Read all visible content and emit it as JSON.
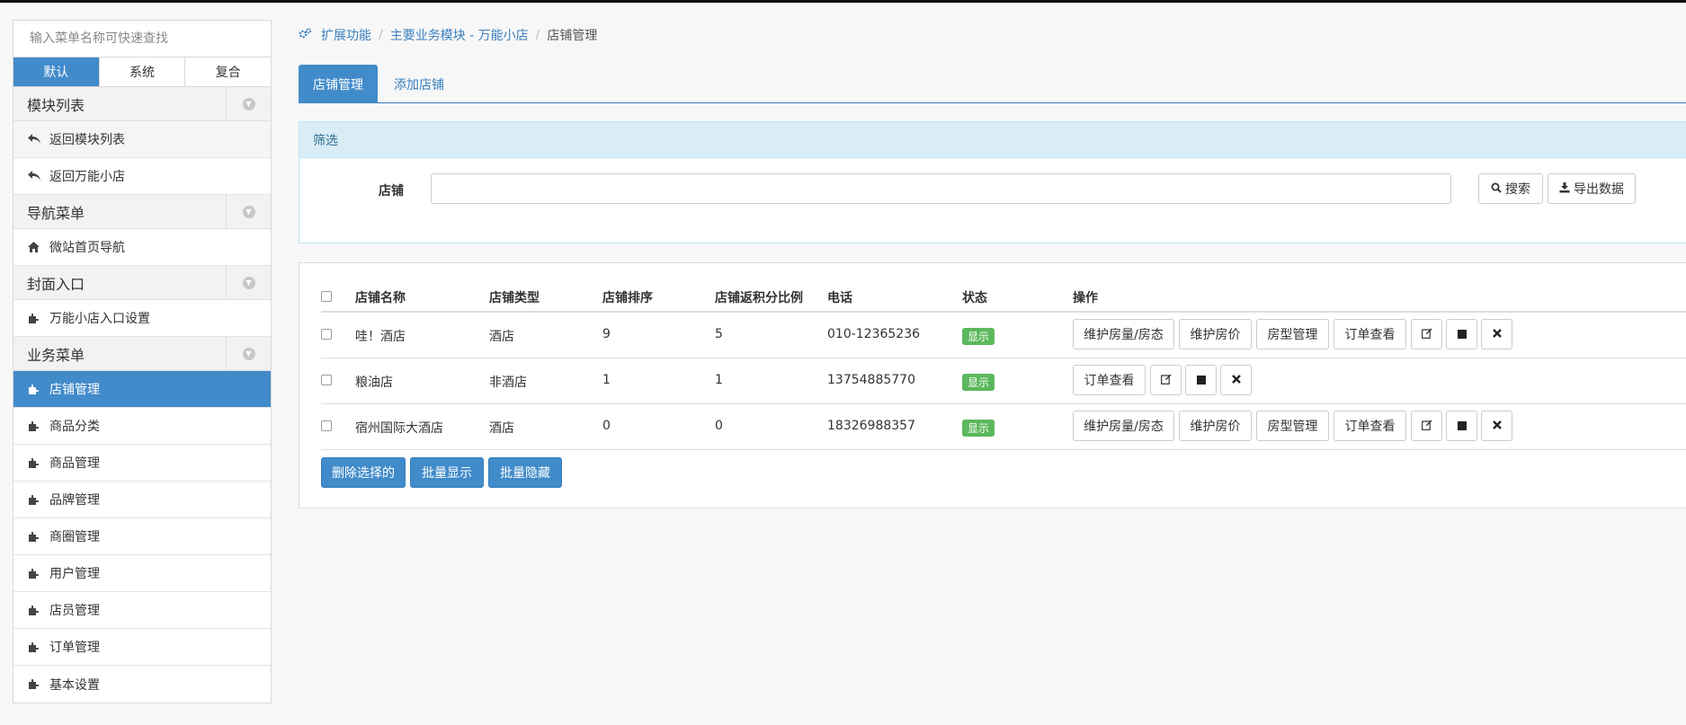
{
  "sidebar": {
    "search_placeholder": "输入菜单名称可快速查找",
    "mode_tabs": [
      "默认",
      "系统",
      "复合"
    ],
    "groups": [
      {
        "title": "模块列表",
        "items": [
          {
            "label": "返回模块列表",
            "icon": "reply-icon"
          },
          {
            "label": "返回万能小店",
            "icon": "reply-icon"
          }
        ]
      },
      {
        "title": "导航菜单",
        "items": [
          {
            "label": "微站首页导航",
            "icon": "home-icon"
          }
        ]
      },
      {
        "title": "封面入口",
        "items": [
          {
            "label": "万能小店入口设置",
            "icon": "puzzle-icon"
          }
        ]
      },
      {
        "title": "业务菜单",
        "items": [
          {
            "label": "店铺管理",
            "icon": "puzzle-icon",
            "active": true
          },
          {
            "label": "商品分类",
            "icon": "puzzle-icon"
          },
          {
            "label": "商品管理",
            "icon": "puzzle-icon"
          },
          {
            "label": "品牌管理",
            "icon": "puzzle-icon"
          },
          {
            "label": "商圈管理",
            "icon": "puzzle-icon"
          },
          {
            "label": "用户管理",
            "icon": "puzzle-icon"
          },
          {
            "label": "店员管理",
            "icon": "puzzle-icon"
          },
          {
            "label": "订单管理",
            "icon": "puzzle-icon"
          },
          {
            "label": "基本设置",
            "icon": "puzzle-icon"
          }
        ]
      }
    ]
  },
  "breadcrumb": {
    "icon": "cogs-icon",
    "items": [
      "扩展功能",
      "主要业务模块 - 万能小店",
      "店铺管理"
    ]
  },
  "tabs": [
    "店铺管理",
    "添加店铺"
  ],
  "filter": {
    "title": "筛选",
    "label": "店铺",
    "input_value": "",
    "search_button": "搜索",
    "export_button": "导出数据"
  },
  "table": {
    "headers": [
      "店铺名称",
      "店铺类型",
      "店铺排序",
      "店铺返积分比例",
      "电话",
      "状态",
      "操作"
    ],
    "rows": [
      {
        "name": "哇！酒店",
        "type": "酒店",
        "sort": "9",
        "ratio": "5",
        "phone": "010-12365236",
        "status": "显示",
        "actions": [
          "维护房量/房态",
          "维护房价",
          "房型管理",
          "订单查看"
        ]
      },
      {
        "name": "粮油店",
        "type": "非酒店",
        "sort": "1",
        "ratio": "1",
        "phone": "13754885770",
        "status": "显示",
        "actions": [
          "订单查看"
        ]
      },
      {
        "name": "宿州国际大酒店",
        "type": "酒店",
        "sort": "0",
        "ratio": "0",
        "phone": "18326988357",
        "status": "显示",
        "actions": [
          "维护房量/房态",
          "维护房价",
          "房型管理",
          "订单查看"
        ]
      }
    ],
    "bulk_actions": [
      "删除选择的",
      "批量显示",
      "批量隐藏"
    ]
  },
  "colors": {
    "primary": "#428bca",
    "success": "#5cb85c",
    "info_bg": "#d9edf7",
    "link": "#3a7fbf"
  }
}
